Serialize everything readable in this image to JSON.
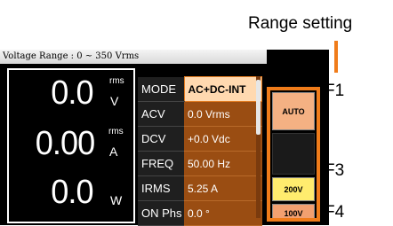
{
  "callout": {
    "title": "Range setting"
  },
  "status": {
    "text": "Voltage Range : 0 ~ 350 Vrms"
  },
  "meters": [
    {
      "value": "0.0",
      "unit": "V",
      "sub": "rms"
    },
    {
      "value": "0.00",
      "unit": "A",
      "sub": "rms"
    },
    {
      "value": "0.0",
      "unit": "W",
      "sub": ""
    }
  ],
  "params": [
    {
      "name": "MODE",
      "value": "AC+DC-INT",
      "selected": true
    },
    {
      "name": "ACV",
      "value": "0.0 Vrms"
    },
    {
      "name": "DCV",
      "value": "+0.0 Vdc"
    },
    {
      "name": "FREQ",
      "value": "50.00 Hz"
    },
    {
      "name": "IRMS",
      "value": "5.25 A"
    },
    {
      "name": "ON Phs",
      "value": "0.0 °"
    }
  ],
  "softkeys": {
    "f1": "AUTO",
    "f3": "200V",
    "f4": "100V"
  },
  "fkeys": {
    "f1": "F1",
    "f3": "F3",
    "f4": "F4"
  },
  "colors": {
    "accent": "#f07c1a",
    "selected_bg": "#ffd9b0",
    "value_bg": "#9a4d12"
  }
}
